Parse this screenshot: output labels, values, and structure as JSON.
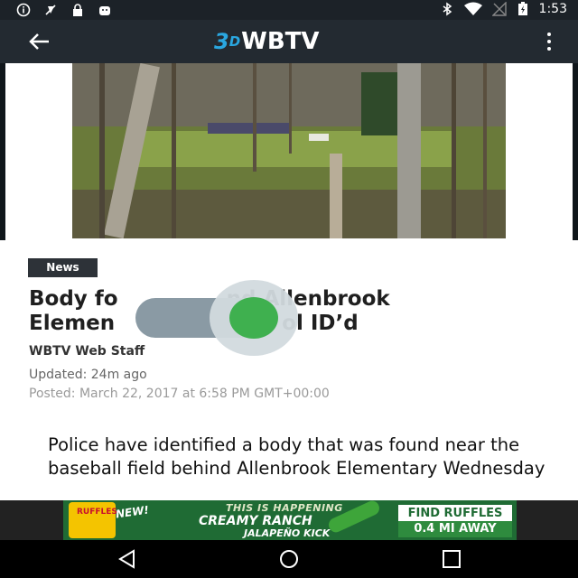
{
  "statusbar": {
    "time": "1:53",
    "icons": [
      "info-icon",
      "no-gps-icon",
      "lock-icon",
      "android-icon",
      "bluetooth-icon",
      "wifi-icon",
      "no-signal-icon",
      "battery-charging-icon"
    ]
  },
  "appbar": {
    "back_icon": "arrow-left-icon",
    "logo_prefix": "3",
    "logo_name": "WBTV",
    "menu_icon": "overflow-menu-icon"
  },
  "article": {
    "tag": "News",
    "headline_line1_left": "Body fo",
    "headline_line1_right": "nd Allenbrook",
    "headline_line2_left": "Elemen",
    "headline_line2_right": "ol ID’d",
    "author": "WBTV Web Staff",
    "updated": "Updated: 24m ago",
    "posted": "Posted: March 22, 2017 at 6:58 PM GMT+00:00",
    "body": "Police have identified a body that was found near the baseball field behind Allenbrook Elementary Wednesday"
  },
  "ad": {
    "brand": "RUFFLES",
    "badge": "NEW!",
    "line1": "THIS IS HAPPENING",
    "line2": "CREAMY RANCH",
    "line3": "JALAPEÑO KICK",
    "cta1": "FIND RUFFLES",
    "cta2": "0.4 MI AWAY"
  },
  "toggle": {
    "state": "on",
    "color": "#3fb04f"
  },
  "navbar": {
    "icons": [
      "back-triangle-icon",
      "home-circle-icon",
      "recents-square-icon"
    ]
  }
}
